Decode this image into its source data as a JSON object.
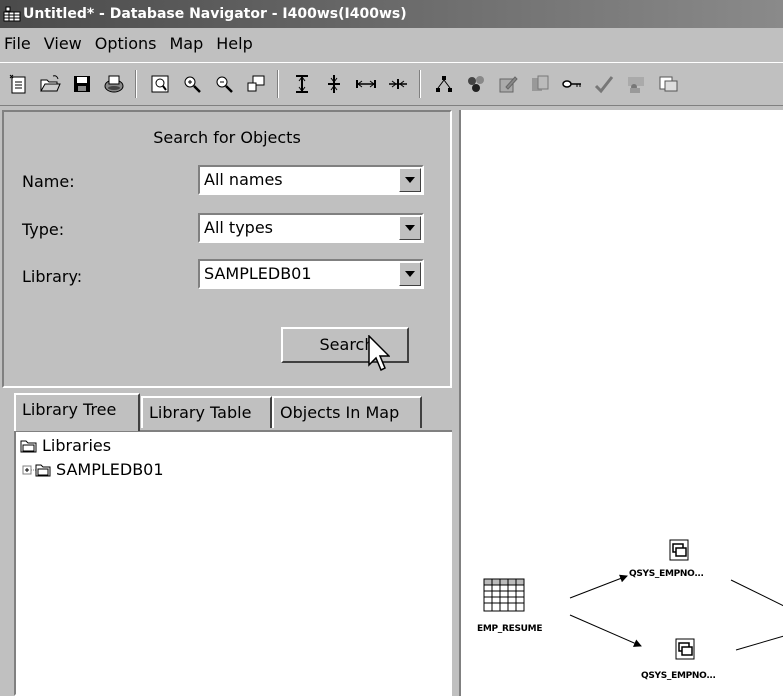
{
  "window": {
    "title": "Untitled* - Database Navigator - I400ws(I400ws)"
  },
  "menu": [
    "File",
    "View",
    "Options",
    "Map",
    "Help"
  ],
  "toolbar": {
    "icons": [
      "new-icon",
      "open-icon",
      "save-icon",
      "print-icon",
      "zoom-fit-icon",
      "zoom-in-icon",
      "zoom-out-icon",
      "restore-icon",
      "expand-vertical-icon",
      "collapse-vertical-icon",
      "expand-horizontal-icon",
      "collapse-horizontal-icon",
      "hierarchy-icon",
      "relationships-icon",
      "edit-icon",
      "objects-icon",
      "key-icon",
      "check-icon",
      "user-icon",
      "copy-icon"
    ]
  },
  "search": {
    "title": "Search for Objects",
    "name_label": "Name:",
    "name_value": "All names",
    "type_label": "Type:",
    "type_value": "All types",
    "library_label": "Library:",
    "library_value": "SAMPLEDB01",
    "button": "Search"
  },
  "tabs": [
    "Library Tree",
    "Library Table",
    "Objects In Map"
  ],
  "active_tab": "Library Tree",
  "tree": {
    "root": "Libraries",
    "children": [
      "SAMPLEDB01"
    ]
  },
  "map": {
    "nodes": [
      {
        "label": "EMP_RESUME",
        "kind": "table"
      },
      {
        "label": "QSYS_EMPNO...",
        "kind": "index"
      },
      {
        "label": "QSYS_EMPNO...",
        "kind": "index"
      }
    ]
  }
}
